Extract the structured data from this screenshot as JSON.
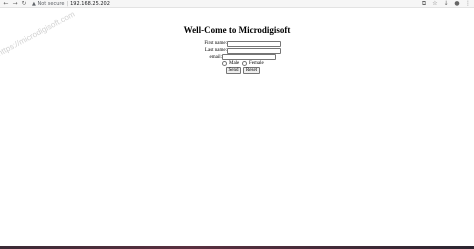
{
  "browser": {
    "security_label": "Not secure",
    "url": "192.168.25.202",
    "icons": [
      "back-icon",
      "forward-icon",
      "reload-icon",
      "info-icon",
      "extension-icon",
      "bookmark-icon",
      "download-icon",
      "profile-icon",
      "menu-icon"
    ]
  },
  "page": {
    "heading": "Well-Come to Microdigisoft",
    "form": {
      "first_name_label": "First name:",
      "first_name_value": "",
      "last_name_label": "Last name:",
      "last_name_value": "",
      "email_label": "email:",
      "email_value": "",
      "gender_options": [
        "Male",
        "Female"
      ],
      "send_label": "Send",
      "reset_label": "Reset"
    }
  },
  "watermark": "https://microdigisoft.com"
}
